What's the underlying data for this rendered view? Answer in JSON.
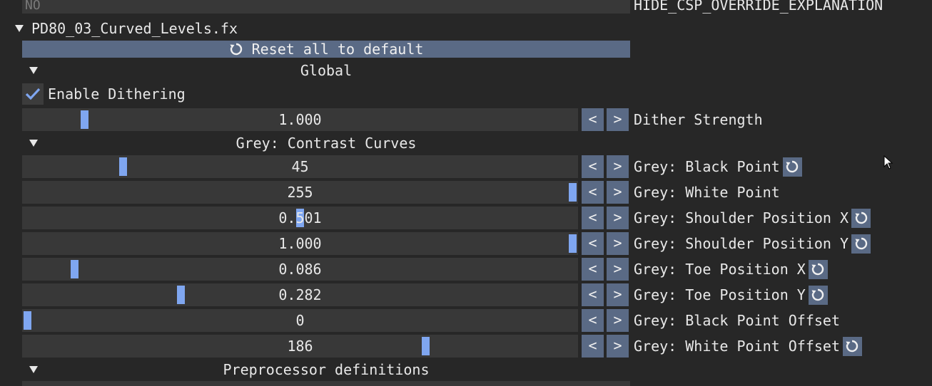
{
  "top_row": {
    "value": "NO",
    "label": "HIDE_CSP_OVERRIDE_EXPLANATION"
  },
  "effect": {
    "name": "PD80_03_Curved_Levels.fx",
    "reset_all_label": "Reset all to default"
  },
  "sections": {
    "global": "Global",
    "grey_curves": "Grey: Contrast Curves",
    "preprocessor": "Preprocessor definitions"
  },
  "checkbox": {
    "label": "Enable Dithering",
    "checked": true
  },
  "buttons": {
    "dec": "<",
    "inc": ">"
  },
  "sliders": [
    {
      "value": "1.000",
      "label": "Dither Strength",
      "fraction": 0.105,
      "has_reset": false
    },
    {
      "value": "45",
      "label": "Grey: Black Point",
      "fraction": 0.176,
      "has_reset": true
    },
    {
      "value": "255",
      "label": "Grey: White Point",
      "fraction": 1.0,
      "has_reset": false
    },
    {
      "value": "0.501",
      "label": "Grey: Shoulder Position X",
      "fraction": 0.5,
      "has_reset": true
    },
    {
      "value": "1.000",
      "label": "Grey: Shoulder Position Y",
      "fraction": 1.0,
      "has_reset": true
    },
    {
      "value": "0.086",
      "label": "Grey: Toe Position X",
      "fraction": 0.086,
      "has_reset": true
    },
    {
      "value": "0.282",
      "label": "Grey: Toe Position Y",
      "fraction": 0.282,
      "has_reset": true
    },
    {
      "value": "0",
      "label": "Grey: Black Point Offset",
      "fraction": 0.0,
      "has_reset": false
    },
    {
      "value": "186",
      "label": "Grey: White Point Offset",
      "fraction": 0.73,
      "has_reset": true
    }
  ]
}
